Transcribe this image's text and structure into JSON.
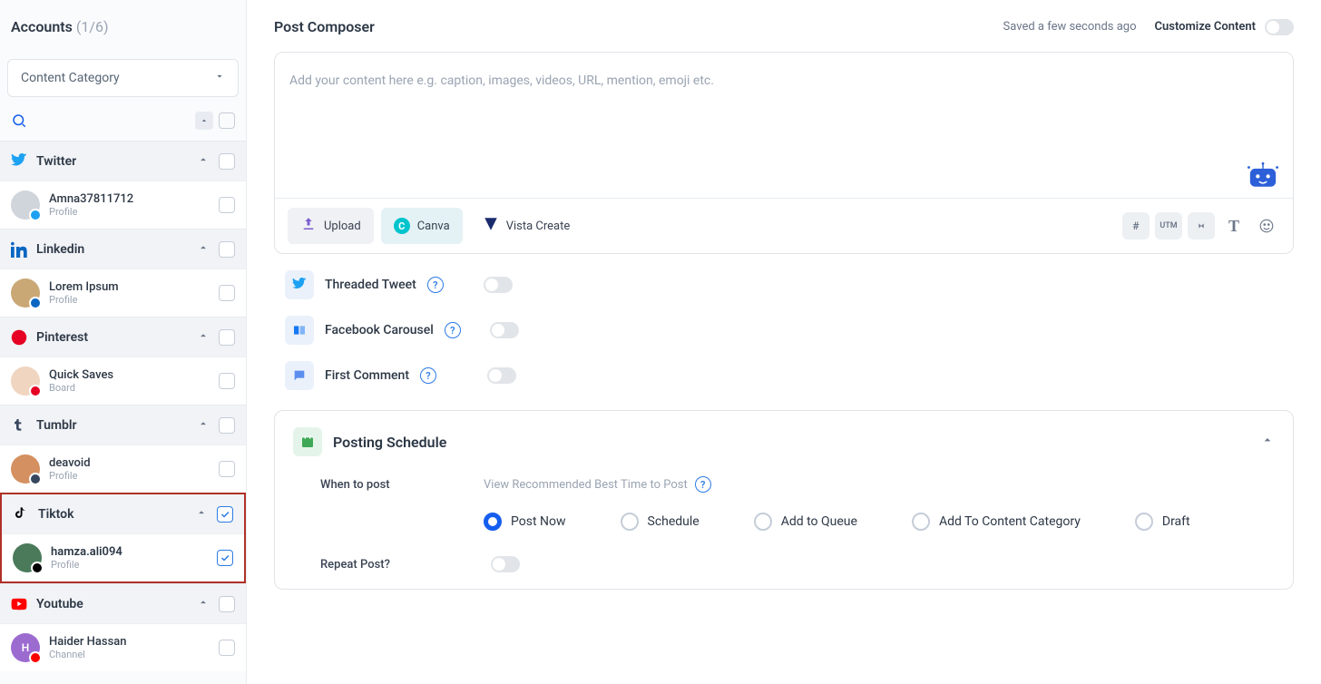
{
  "sidebar": {
    "title": "Accounts",
    "count": "(1/6)",
    "category_label": "Content Category",
    "platforms": [
      {
        "name": "Twitter",
        "accounts": [
          {
            "name": "Amna37811712",
            "sub": "Profile",
            "badge": "#1da1f2"
          }
        ],
        "checked": false
      },
      {
        "name": "Linkedin",
        "accounts": [
          {
            "name": "Lorem Ipsum",
            "sub": "Profile",
            "badge": "#0a66c2"
          }
        ],
        "checked": false
      },
      {
        "name": "Pinterest",
        "accounts": [
          {
            "name": "Quick Saves",
            "sub": "Board",
            "badge": "#e60023"
          }
        ],
        "checked": false
      },
      {
        "name": "Tumblr",
        "accounts": [
          {
            "name": "deavoid",
            "sub": "Profile",
            "badge": "#36465d"
          }
        ],
        "checked": false
      },
      {
        "name": "Tiktok",
        "accounts": [
          {
            "name": "hamza.ali094",
            "sub": "Profile",
            "badge": "#000"
          }
        ],
        "checked": true,
        "highlight": true
      },
      {
        "name": "Youtube",
        "accounts": [
          {
            "name": "Haider Hassan",
            "sub": "Channel",
            "badge": "#ff0000"
          }
        ],
        "checked": false
      }
    ]
  },
  "main": {
    "title": "Post Composer",
    "saved": "Saved a few seconds ago",
    "customize": "Customize Content",
    "placeholder": "Add your content here e.g. caption, images, videos, URL, mention, emoji etc.",
    "upload": "Upload",
    "canva": "Canva",
    "vista": "Vista Create",
    "threaded": "Threaded Tweet",
    "carousel": "Facebook Carousel",
    "first_comment": "First Comment",
    "schedule_title": "Posting Schedule",
    "when_label": "When to post",
    "recommend": "View Recommended Best Time to Post",
    "radios": [
      "Post Now",
      "Schedule",
      "Add to Queue",
      "Add To Content Category",
      "Draft"
    ],
    "repeat": "Repeat Post?"
  },
  "colors": {
    "twitter": "#1da1f2",
    "linkedin": "#0a66c2",
    "pinterest": "#e60023",
    "tumblr": "#36465d",
    "tiktok": "#000",
    "youtube": "#ff0000"
  }
}
